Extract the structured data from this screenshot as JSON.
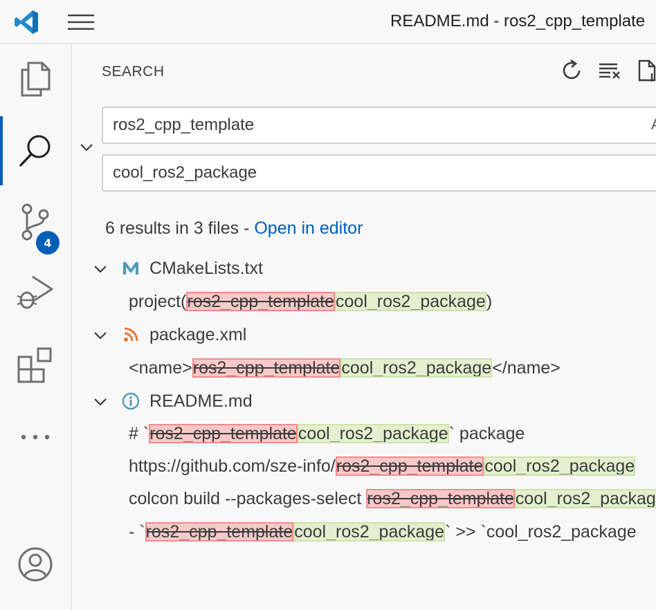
{
  "window": {
    "title": "README.md - ros2_cpp_template"
  },
  "activity_bar": {
    "items": [
      {
        "name": "explorer"
      },
      {
        "name": "search",
        "active": true
      },
      {
        "name": "source-control",
        "badge": "4"
      },
      {
        "name": "run-debug"
      },
      {
        "name": "extensions"
      },
      {
        "name": "more"
      },
      {
        "name": "accounts"
      }
    ]
  },
  "search": {
    "title": "SEARCH",
    "query": "ros2_cpp_template",
    "replace": "cool_ros2_package",
    "field_extra": "A",
    "summary": "6 results in 3 files - ",
    "open_in_editor": "Open in editor",
    "find_text": "ros2_cpp_template",
    "replace_text": "cool_ros2_package"
  },
  "results": [
    {
      "file": "CMakeLists.txt",
      "icon": "cmake-m-icon",
      "icon_color": "#519aba",
      "matches": [
        {
          "before": "project(",
          "after": ")"
        }
      ]
    },
    {
      "file": "package.xml",
      "icon": "rss-icon",
      "icon_color": "#e37933",
      "matches": [
        {
          "before": "<name>",
          "after": "</name>"
        }
      ]
    },
    {
      "file": "README.md",
      "icon": "info-icon",
      "icon_color": "#519aba",
      "matches": [
        {
          "before": "# `",
          "after": "` package"
        },
        {
          "before": "https://github.com/sze-info/",
          "after": ""
        },
        {
          "before": "colcon build --packages-select ",
          "after": ""
        },
        {
          "before": "- `",
          "after": "` >> `cool_ros2_package"
        }
      ]
    }
  ],
  "colors": {
    "accent": "#005fb8",
    "removed_bg": "#f8c9c9",
    "inserted_bg": "#e4efcf"
  }
}
